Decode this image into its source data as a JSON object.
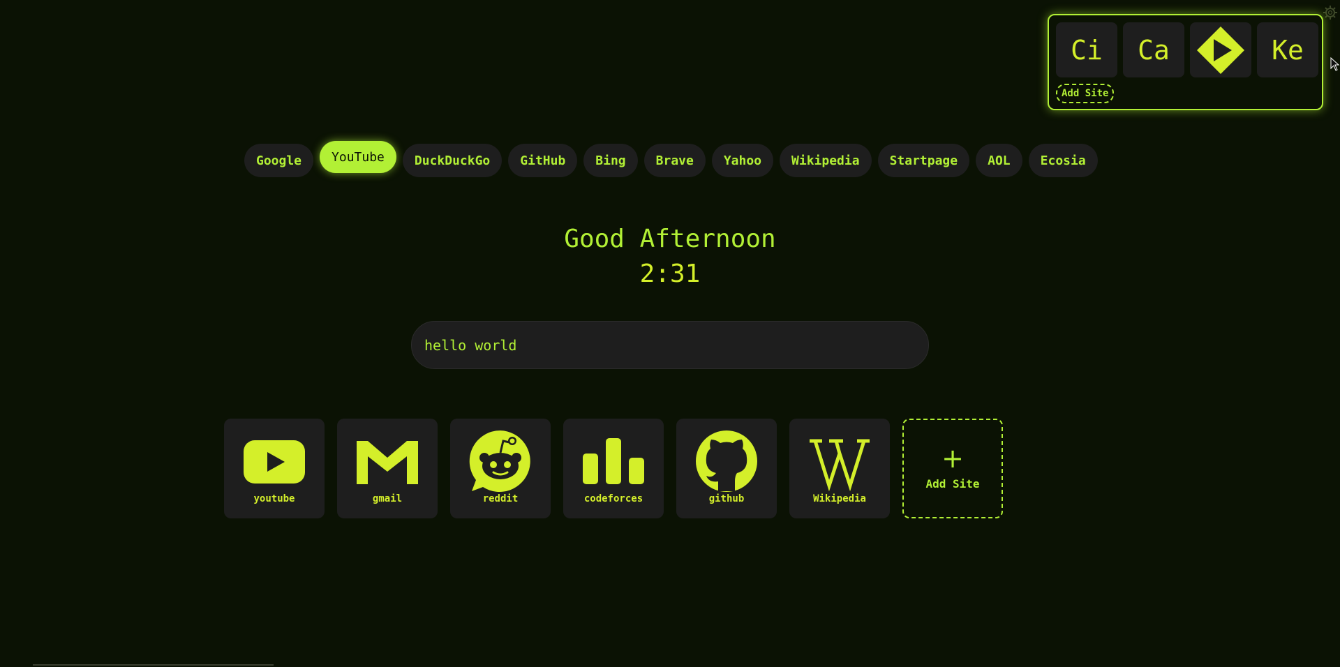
{
  "colors": {
    "background": "#0b1204",
    "accent": "#b2f035",
    "accent_bright": "#d4ef2a",
    "tile": "#1e1e1e"
  },
  "quick_panel": {
    "tiles": [
      {
        "label": "Ci",
        "icon": null
      },
      {
        "label": "Ca",
        "icon": null
      },
      {
        "label": "",
        "icon": "play-diamond-icon"
      },
      {
        "label": "Ke",
        "icon": null
      }
    ],
    "add_label": "Add Site"
  },
  "engines": {
    "items": [
      "Google",
      "YouTube",
      "DuckDuckGo",
      "GitHub",
      "Bing",
      "Brave",
      "Yahoo",
      "Wikipedia",
      "Startpage",
      "AOL",
      "Ecosia"
    ],
    "active": "YouTube"
  },
  "greeting": "Good Afternoon",
  "clock": "2:31",
  "search": {
    "value": "hello world",
    "placeholder": ""
  },
  "shortcuts": [
    {
      "label": "youtube",
      "icon": "youtube-icon"
    },
    {
      "label": "gmail",
      "icon": "gmail-icon"
    },
    {
      "label": "reddit",
      "icon": "reddit-icon"
    },
    {
      "label": "codeforces",
      "icon": "codeforces-icon"
    },
    {
      "label": "github",
      "icon": "github-icon"
    },
    {
      "label": "Wikipedia",
      "icon": "wikipedia-icon"
    }
  ],
  "add_shortcut": {
    "symbol": "+",
    "label": "Add Site"
  }
}
